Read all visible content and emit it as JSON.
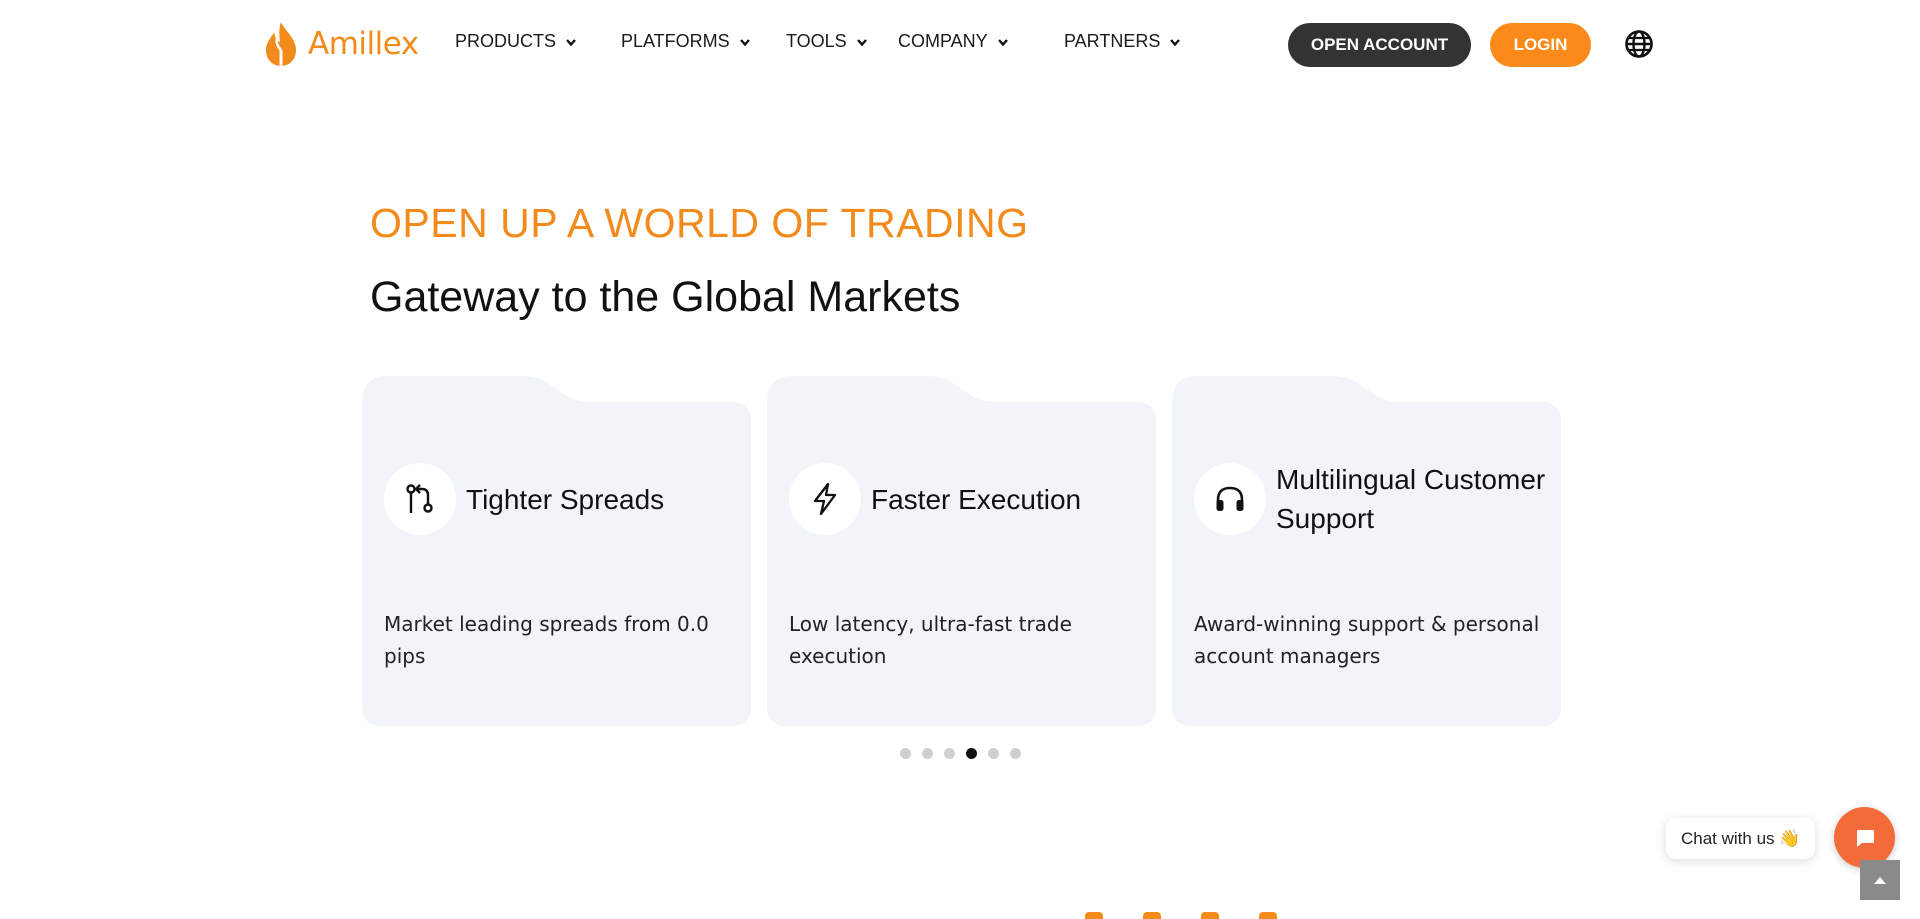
{
  "brand": {
    "name": "Amillex",
    "color": "#f28a1c"
  },
  "nav": {
    "items": [
      {
        "label": "PRODUCTS"
      },
      {
        "label": "PLATFORMS"
      },
      {
        "label": "TOOLS"
      },
      {
        "label": "COMPANY"
      },
      {
        "label": "PARTNERS"
      }
    ],
    "open_account_label": "OPEN ACCOUNT",
    "login_label": "LOGIN",
    "language_icon": "globe-icon"
  },
  "hero": {
    "kicker": "OPEN UP A WORLD OF TRADING",
    "title": "Gateway to the Global Markets"
  },
  "features": [
    {
      "icon": "spread-icon",
      "title": "Tighter Spreads",
      "description": "Market leading spreads from 0.0 pips"
    },
    {
      "icon": "lightning-icon",
      "title": "Faster Execution",
      "description": "Low latency, ultra-fast trade execution"
    },
    {
      "icon": "headphones-icon",
      "title": "Multilingual Customer Support",
      "description": "Award-winning support & personal account managers"
    }
  ],
  "carousel": {
    "total_dots": 6,
    "active_dot": 4
  },
  "chat": {
    "label": "Chat with us 👋",
    "icon": "chat-icon"
  },
  "colors": {
    "accent": "#fb8a1a",
    "dark_button": "#333333",
    "card_bg": "#f1f4f9",
    "chat": "#f26b38"
  }
}
